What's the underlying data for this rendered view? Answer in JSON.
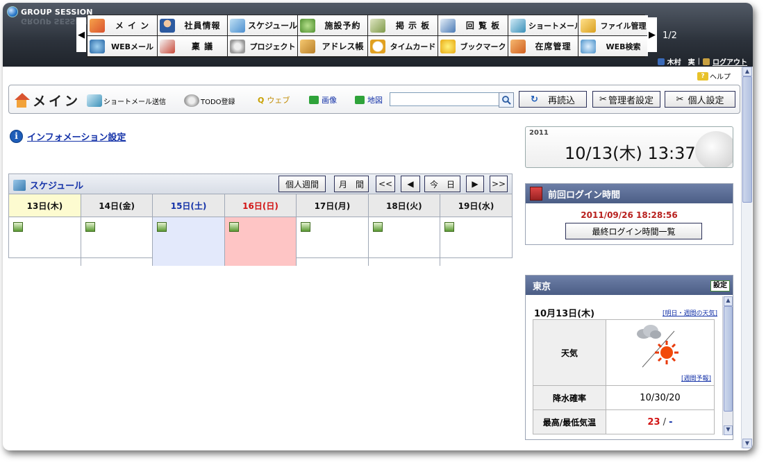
{
  "app": {
    "name": "GROUP SESSION"
  },
  "nav": {
    "page_indicator": "1/2",
    "modules": [
      {
        "label": "メ イ ン",
        "icon": "main-house-icon",
        "color": "#e0722e"
      },
      {
        "label": "社員情報",
        "icon": "user-info-icon",
        "color": "#d08a5a"
      },
      {
        "label": "スケジュール",
        "icon": "schedule-icon",
        "color": "#4c8fcf"
      },
      {
        "label": "施設予約",
        "icon": "reservation-icon",
        "color": "#6aa84f"
      },
      {
        "label": "掲 示 板",
        "icon": "bulletin-icon",
        "color": "#8a9a5a"
      },
      {
        "label": "回 覧 板",
        "icon": "circular-icon",
        "color": "#4a7ab5"
      },
      {
        "label": "ショートメール",
        "icon": "short-mail-icon",
        "color": "#5aa3c8"
      },
      {
        "label": "ファイル管理",
        "icon": "file-manage-icon",
        "color": "#e0b53a"
      },
      {
        "label": "WEBメール",
        "icon": "web-mail-icon",
        "color": "#3d8ac2"
      },
      {
        "label": "稟 議",
        "icon": "ringi-icon",
        "color": "#c84a3a"
      },
      {
        "label": "プロジェクト",
        "icon": "project-gear-icon",
        "color": "#9a9a9a"
      },
      {
        "label": "アドレス帳",
        "icon": "address-book-icon",
        "color": "#e0a03a"
      },
      {
        "label": "タイムカード",
        "icon": "timecard-clock-icon",
        "color": "#e0c04a"
      },
      {
        "label": "ブックマーク",
        "icon": "bookmark-star-icon",
        "color": "#f2c81a"
      },
      {
        "label": "在席管理",
        "icon": "presence-chair-icon",
        "color": "#e0803a"
      },
      {
        "label": "WEB検索",
        "icon": "web-search-icon",
        "color": "#4a90c8"
      }
    ]
  },
  "user": {
    "name": "木村　実",
    "separator": "|",
    "logout": "ログアウト"
  },
  "help": {
    "label": "ヘルプ"
  },
  "toolbar": {
    "title": "メイン",
    "short_mail": "ショートメール送信",
    "todo": "TODO登録",
    "search_types": [
      "ウェブ",
      "画像",
      "地図"
    ],
    "search_value": "",
    "reload": "再読込",
    "admin": "管理者設定",
    "personal": "個人設定"
  },
  "info": {
    "label": "インフォメーション設定"
  },
  "schedule": {
    "title": "スケジュール",
    "buttons": {
      "personal_week": "個人週間",
      "month": "月　間",
      "prev_week": "<<",
      "prev": "◀",
      "today": "今　日",
      "next": "▶",
      "next_week": ">>"
    },
    "days": [
      {
        "label": "13日(木)",
        "kind": "today"
      },
      {
        "label": "14日(金)",
        "kind": "weekday"
      },
      {
        "label": "15日(土)",
        "kind": "saturday"
      },
      {
        "label": "16日(日)",
        "kind": "sunday"
      },
      {
        "label": "17日(月)",
        "kind": "weekday"
      },
      {
        "label": "18日(火)",
        "kind": "weekday"
      },
      {
        "label": "19日(水)",
        "kind": "weekday"
      }
    ]
  },
  "clock": {
    "year": "2011",
    "datetime": "10/13(木) 13:37"
  },
  "last_login": {
    "title": "前回ログイン時間",
    "datetime": "2011/09/26 18:28:56",
    "button": "最終ログイン時間一覧"
  },
  "weather": {
    "city": "東京",
    "settings": "設定",
    "date": "10月13日(木)",
    "forecast_link": "[明日・週間の天気]",
    "weekly_link": "[週間予報]",
    "rows": {
      "weather": "天気",
      "precip_label": "降水確率",
      "precip": "10/30/20",
      "temp_label": "最高/最低気温",
      "high": "23",
      "slash": "/",
      "low": "-"
    },
    "conditions": [
      "cloudy-icon",
      "sunny-icon"
    ]
  },
  "colors": {
    "header": "#2c323b",
    "panel_header": "#5a6c95",
    "today": "#fdfbd0",
    "saturday": "#e3e9fb",
    "sunday": "#fec5c5",
    "link": "#1432a8",
    "alert": "#b8201e"
  }
}
